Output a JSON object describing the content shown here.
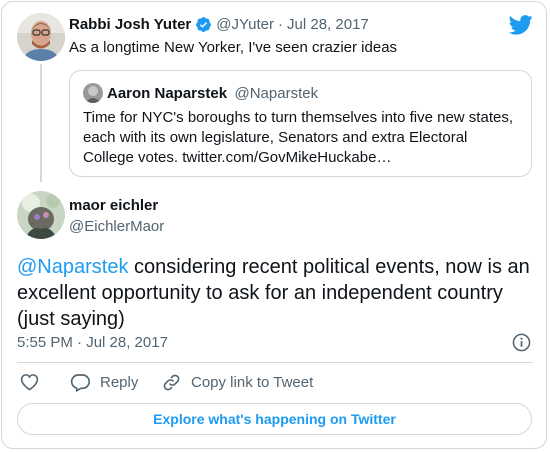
{
  "colors": {
    "brand": "#1d9bf0",
    "text": "#0f1419",
    "muted": "#536471",
    "border": "#cfd9de"
  },
  "reply_tweet": {
    "author_name": "Rabbi Josh Yuter",
    "handle": "@JYuter",
    "separator": "·",
    "date": "Jul 28, 2017",
    "text": "As a longtime New Yorker, I've seen crazier ideas",
    "verified_icon": "verified-badge-icon",
    "platform_icon": "twitter-bird-icon"
  },
  "quoted_tweet": {
    "author_name": "Aaron Naparstek",
    "handle": "@Naparstek",
    "text_lines": [
      "Time for NYC's boroughs to turn themselves into five new states,",
      "each with its own legislature, Senators and extra Electoral",
      "College votes. twitter.com/GovMikeHuckabe…"
    ]
  },
  "main_tweet": {
    "author_name": "maor eichler",
    "handle": "@EichlerMaor",
    "mention": "@Naparstek",
    "text_line1_rest": " considering recent political events, now is an",
    "text_line2": "excellent opportunity to ask for an independent country",
    "text_line3": "(just saying)",
    "timestamp": "5:55 PM · Jul 28, 2017",
    "info_icon": "info-icon"
  },
  "actions": {
    "like_icon": "heart-icon",
    "reply_icon": "reply-bubble-icon",
    "reply_label": "Reply",
    "copy_icon": "link-icon",
    "copy_label": "Copy link to Tweet"
  },
  "explore_label": "Explore what's happening on Twitter"
}
